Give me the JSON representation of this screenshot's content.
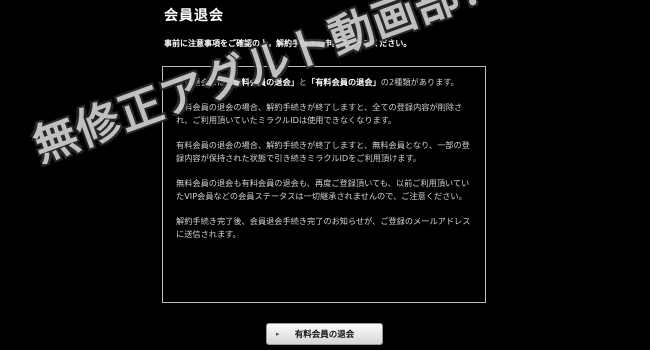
{
  "page": {
    "title": "会員退会",
    "instruction": "事前に注意事項をご確認の上，解約手続きの申請を行ってください。"
  },
  "notice": {
    "p1_before": "会員退会には",
    "p1_free": "「無料会員の退会」",
    "p1_mid": "と",
    "p1_paid": "「有料会員の退会」",
    "p1_after": "の2種類があります。",
    "p2": "無料会員の退会の場合、解約手続きが終了しますと、全ての登録内容が削除され、ご利用頂いていたミラクルIDは使用できなくなります。",
    "p3": "有料会員の退会の場合、解約手続きが終了しますと、無料会員となり、一部の登録内容が保持された状態で引き続きミラクルIDをご利用頂けます。",
    "p4": "無料会員の退会も有料会員の退会も、再度ご登録頂いても、以前ご利用頂いていたVIP会員などの会員ステータスは一切継承されませんので、ご注意ください。",
    "p5": "解約手続き完了後、会員退会手続き完了のお知らせが、ご登録のメールアドレスに送信されます。"
  },
  "buttons": {
    "withdraw_paid": "有料会員の退会",
    "chevron": "▸"
  },
  "watermark": {
    "text": "無修正アダルト動画部！"
  }
}
